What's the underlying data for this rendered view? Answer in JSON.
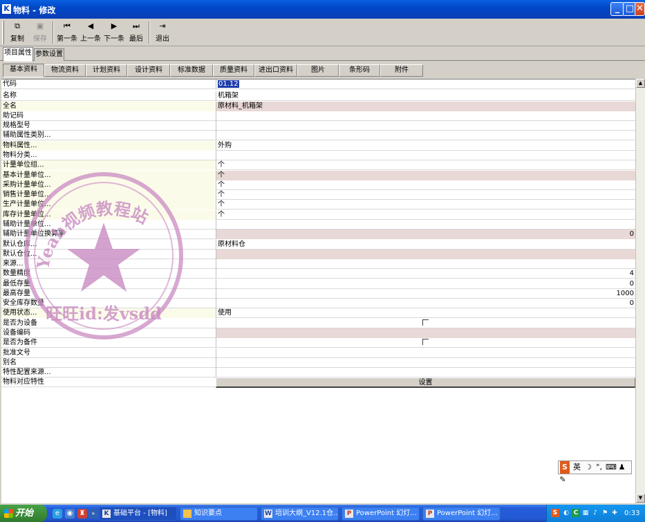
{
  "window": {
    "title": "物料 - 修改",
    "app_icon": "K"
  },
  "toolbar": {
    "buttons": [
      {
        "label": "复制",
        "icon": "copy-icon",
        "enabled": true
      },
      {
        "label": "保存",
        "icon": "save-icon",
        "enabled": false
      },
      {
        "label": "第一条",
        "icon": "first-icon",
        "enabled": true
      },
      {
        "label": "上一条",
        "icon": "prev-icon",
        "enabled": true
      },
      {
        "label": "下一条",
        "icon": "next-icon",
        "enabled": true
      },
      {
        "label": "最后",
        "icon": "last-icon",
        "enabled": true
      },
      {
        "label": "退出",
        "icon": "exit-icon",
        "enabled": true
      }
    ]
  },
  "outer_tabs": [
    "项目属性",
    "参数设置"
  ],
  "inner_tabs": [
    "基本资料",
    "物流资料",
    "计划资料",
    "设计资料",
    "标准数据",
    "质量资料",
    "进出口资料",
    "图片",
    "条形码",
    "附件"
  ],
  "grid": {
    "rows": [
      {
        "label": "代码",
        "value": "01.12"
      },
      {
        "label": "名称",
        "value": "机箱架"
      },
      {
        "label": "全名",
        "value": "原材料_机箱架"
      },
      {
        "label": "助记码",
        "value": ""
      },
      {
        "label": "规格型号",
        "value": ""
      },
      {
        "label": "辅助属性类别...",
        "value": ""
      },
      {
        "label": "物料属性...",
        "value": "外购"
      },
      {
        "label": "物料分类...",
        "value": ""
      },
      {
        "label": "计量单位组...",
        "value": "个"
      },
      {
        "label": "基本计量单位...",
        "value": "个"
      },
      {
        "label": "采购计量单位...",
        "value": "个"
      },
      {
        "label": "销售计量单位...",
        "value": "个"
      },
      {
        "label": "生产计量单位...",
        "value": "个"
      },
      {
        "label": "库存计量单位...",
        "value": "个"
      },
      {
        "label": "辅助计量单位...",
        "value": ""
      },
      {
        "label": "辅助计量单位换算率",
        "value": "0"
      },
      {
        "label": "默认仓库...",
        "value": "原材料仓"
      },
      {
        "label": "默认仓位...",
        "value": ""
      },
      {
        "label": "来源...",
        "value": ""
      },
      {
        "label": "数量精度",
        "value": "4"
      },
      {
        "label": "最低存量",
        "value": "0"
      },
      {
        "label": "最高存量",
        "value": "1000"
      },
      {
        "label": "安全库存数量",
        "value": "0"
      },
      {
        "label": "使用状态...",
        "value": "使用"
      },
      {
        "label": "是否为设备",
        "value": ""
      },
      {
        "label": "设备编码",
        "value": ""
      },
      {
        "label": "是否为备件",
        "value": ""
      },
      {
        "label": "批准文号",
        "value": ""
      },
      {
        "label": "别名",
        "value": ""
      },
      {
        "label": "特性配置来源...",
        "value": ""
      },
      {
        "label": "物料对应特性",
        "value": "设置"
      }
    ]
  },
  "stamp": {
    "text_arc": "Yeah视频教程站",
    "text_bottom": "旺旺id:发vsdd"
  },
  "ime": {
    "label": "英"
  },
  "taskbar": {
    "start": "开始",
    "tasks": [
      {
        "label": "基础平台 - [物料]",
        "icon": "K"
      },
      {
        "label": "知识要点",
        "icon": "folder"
      },
      {
        "label": "培训大纲_V12.1仓...",
        "icon": "W"
      },
      {
        "label": "PowerPoint 幻灯...",
        "icon": "P"
      },
      {
        "label": "PowerPoint 幻灯...",
        "icon": "P"
      }
    ],
    "clock": "0:33"
  },
  "colors": {
    "title_blue": "#0047c8",
    "grid_pink": "#e8d8d6",
    "stamp": "#c98bc2"
  }
}
